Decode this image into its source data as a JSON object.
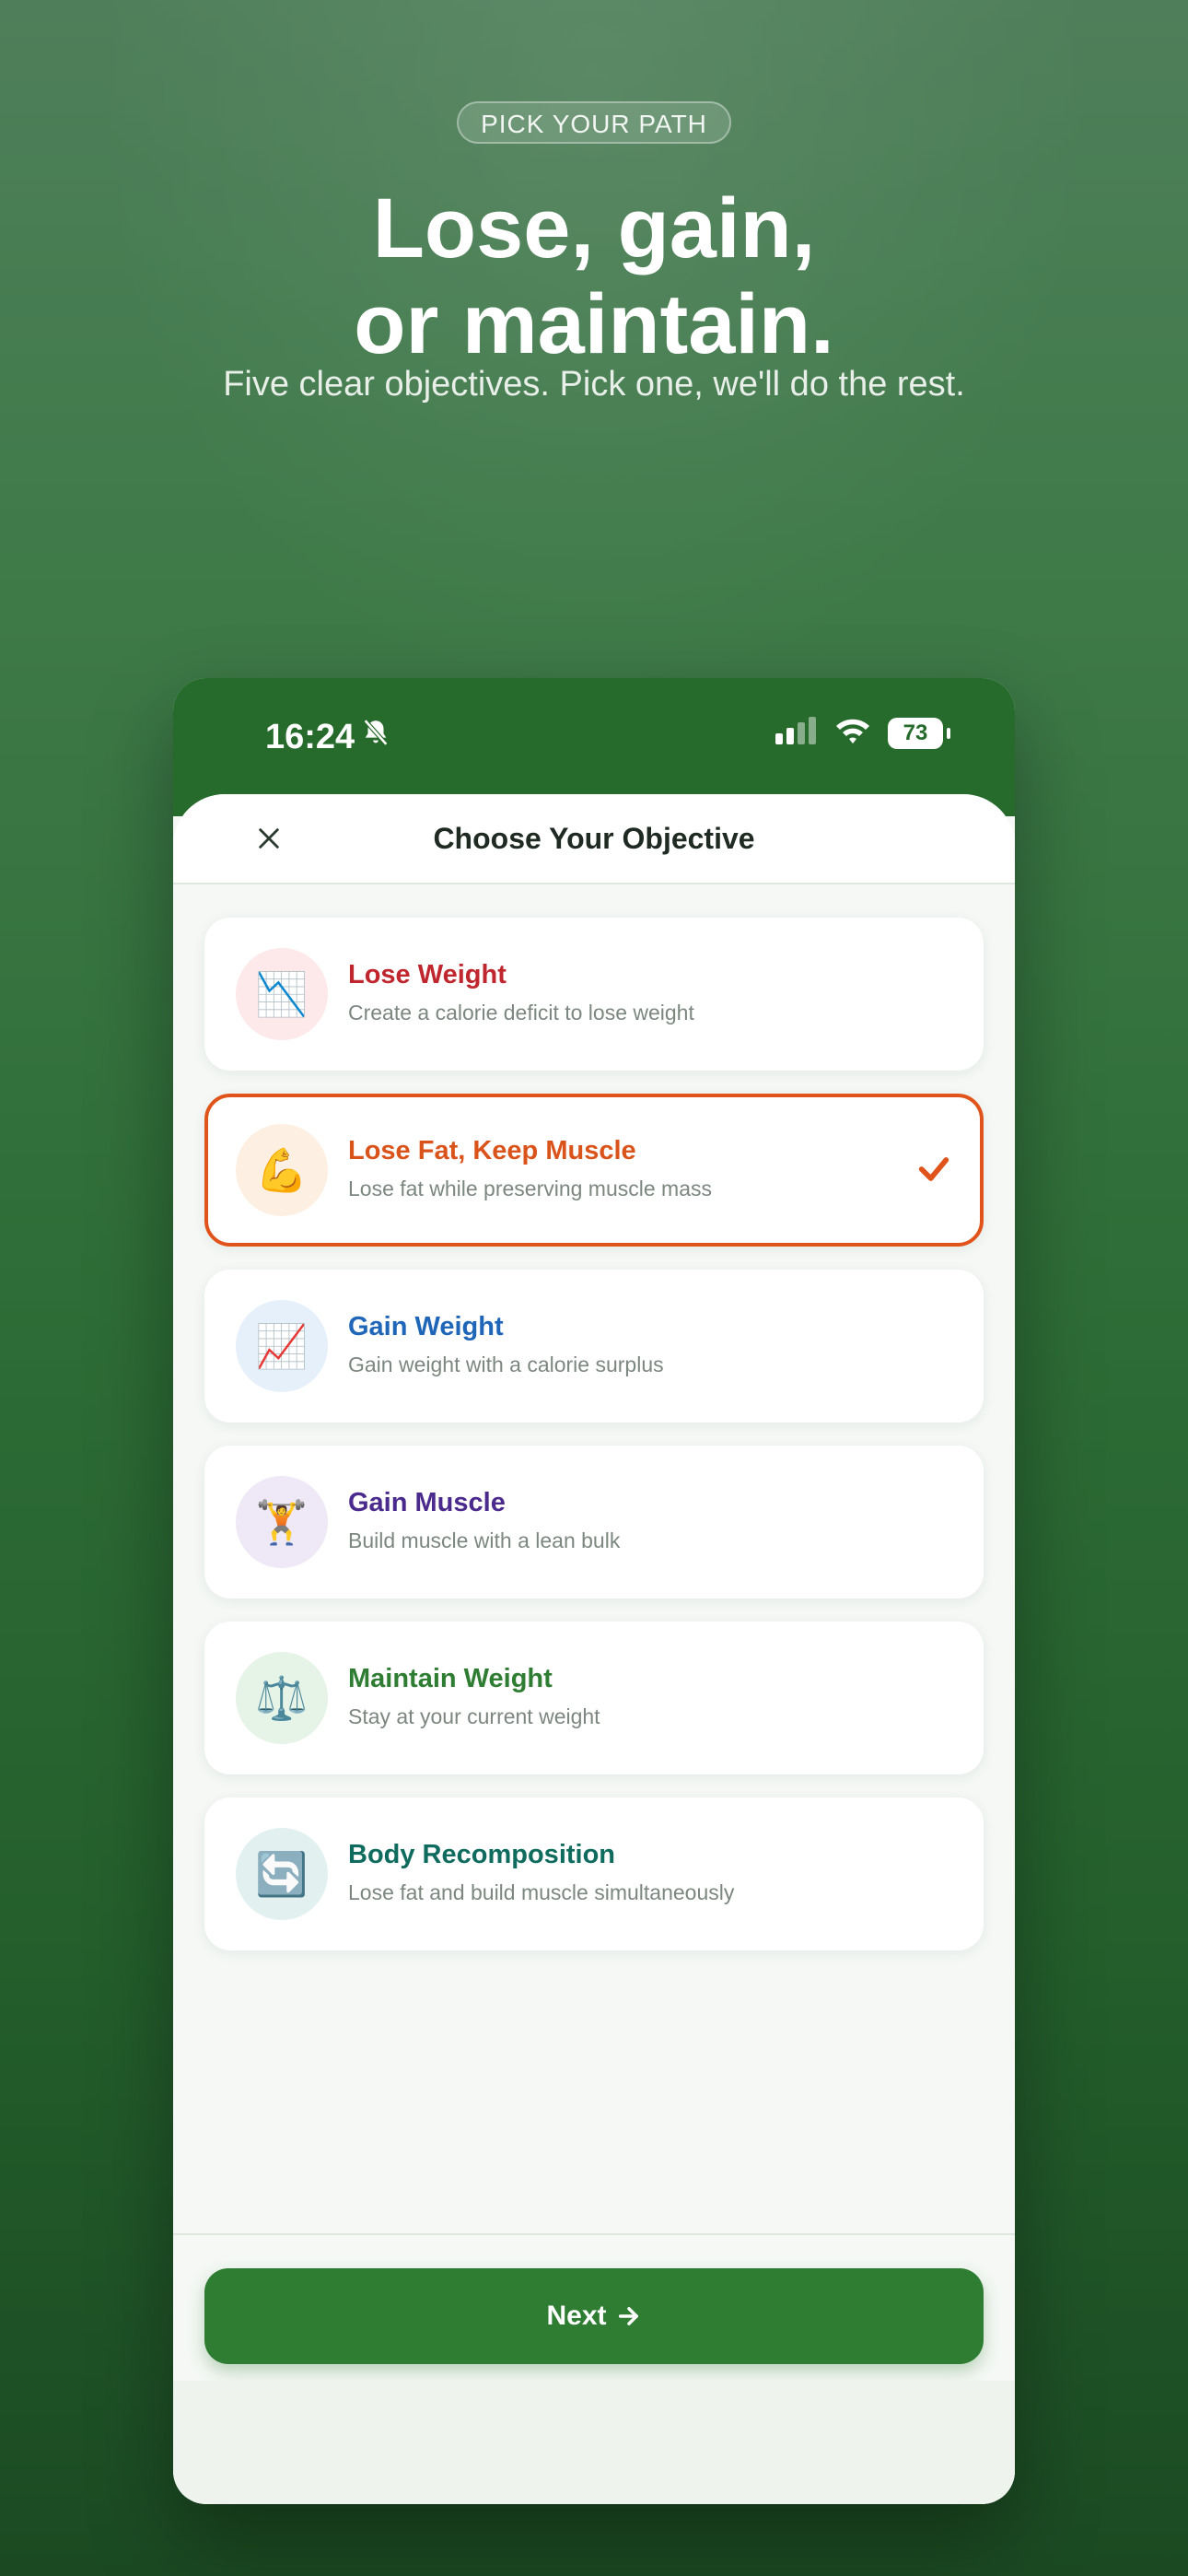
{
  "hero": {
    "pill": "PICK YOUR PATH",
    "headline_line1": "Lose, gain,",
    "headline_line2": "or maintain.",
    "subtitle": "Five clear objectives. Pick one, we'll do the rest."
  },
  "status_bar": {
    "time": "16:24",
    "battery": "73",
    "icons": [
      "bell-slash-icon",
      "signal-icon",
      "wifi-icon",
      "battery-icon"
    ]
  },
  "sheet": {
    "title": "Choose Your Objective",
    "close_icon": "close-icon"
  },
  "objectives": [
    {
      "title": "Lose Weight",
      "desc": "Create a calorie deficit to lose weight",
      "icon": "📉",
      "icon_name": "chart-decreasing-icon",
      "title_color": "#c0262d",
      "icon_bg": "#fde8ea",
      "selected": false
    },
    {
      "title": "Lose Fat, Keep Muscle",
      "desc": "Lose fat while preserving muscle mass",
      "icon": "💪",
      "icon_name": "flexed-biceps-icon",
      "title_color": "#d9531a",
      "icon_bg": "#fdf0e2",
      "selected": true
    },
    {
      "title": "Gain Weight",
      "desc": "Gain weight with a calorie surplus",
      "icon": "📈",
      "icon_name": "chart-increasing-icon",
      "title_color": "#1f66b8",
      "icon_bg": "#e5f0fb",
      "selected": false
    },
    {
      "title": "Gain Muscle",
      "desc": "Build muscle with a lean bulk",
      "icon": "🏋️",
      "icon_name": "weightlifter-icon",
      "title_color": "#4a2a8c",
      "icon_bg": "#efe8f6",
      "selected": false
    },
    {
      "title": "Maintain Weight",
      "desc": "Stay at your current weight",
      "icon": "⚖️",
      "icon_name": "balance-scale-icon",
      "title_color": "#2e7d32",
      "icon_bg": "#e6f3e7",
      "selected": false
    },
    {
      "title": "Body Recomposition",
      "desc": "Lose fat and build muscle simultaneously",
      "icon": "🔄",
      "icon_name": "refresh-arrows-icon",
      "title_color": "#0f6b5e",
      "icon_bg": "#e2f1ef",
      "selected": false
    }
  ],
  "footer": {
    "next_label": "Next",
    "next_icon": "arrow-right-icon"
  },
  "colors": {
    "primary_green": "#2e7d32",
    "status_green": "#266b2c",
    "selection_orange": "#e0531a"
  }
}
